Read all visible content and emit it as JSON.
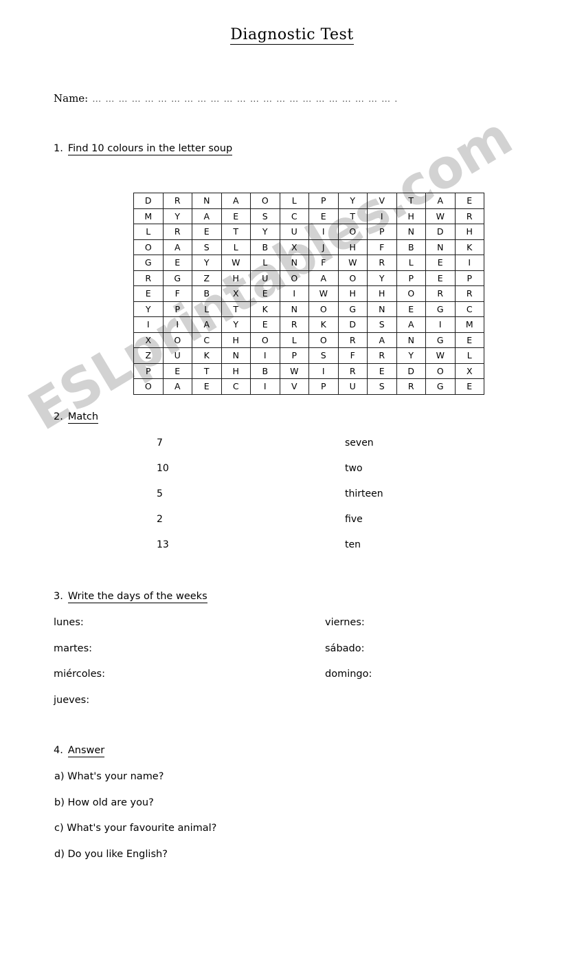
{
  "document": {
    "title": "Diagnostic Test",
    "watermark": "ESLprintables.com",
    "name_field": {
      "label": "Name:",
      "dots": "… … … … … … … … … … … … … … … … … … … … … … … ."
    }
  },
  "exercises": [
    {
      "number": "1.",
      "heading": "Find 10 colours in the letter soup"
    },
    {
      "number": "2.",
      "heading": "Match"
    },
    {
      "number": "3.",
      "heading": "Write the days of the weeks"
    },
    {
      "number": "4.",
      "heading": "Answer"
    }
  ],
  "word_search": {
    "rows": 13,
    "cols": 12,
    "grid": [
      [
        "D",
        "R",
        "N",
        "A",
        "O",
        "L",
        "P",
        "Y",
        "V",
        "T",
        "A",
        "E"
      ],
      [
        "M",
        "Y",
        "A",
        "E",
        "S",
        "C",
        "E",
        "T",
        "I",
        "H",
        "W",
        "R"
      ],
      [
        "L",
        "R",
        "E",
        "T",
        "Y",
        "U",
        "I",
        "O",
        "P",
        "N",
        "D",
        "H"
      ],
      [
        "O",
        "A",
        "S",
        "L",
        "B",
        "X",
        "J",
        "H",
        "F",
        "B",
        "N",
        "K"
      ],
      [
        "G",
        "E",
        "Y",
        "W",
        "L",
        "N",
        "F",
        "W",
        "R",
        "L",
        "E",
        "I"
      ],
      [
        "R",
        "G",
        "Z",
        "H",
        "U",
        "O",
        "A",
        "O",
        "Y",
        "P",
        "E",
        "P"
      ],
      [
        "E",
        "F",
        "B",
        "X",
        "E",
        "I",
        "W",
        "H",
        "H",
        "O",
        "R",
        "R"
      ],
      [
        "Y",
        "P",
        "L",
        "T",
        "K",
        "N",
        "O",
        "G",
        "N",
        "E",
        "G",
        "C"
      ],
      [
        "I",
        "I",
        "A",
        "Y",
        "E",
        "R",
        "K",
        "D",
        "S",
        "A",
        "I",
        "M"
      ],
      [
        "X",
        "O",
        "C",
        "H",
        "O",
        "L",
        "O",
        "R",
        "A",
        "N",
        "G",
        "E"
      ],
      [
        "Z",
        "U",
        "K",
        "N",
        "I",
        "P",
        "S",
        "F",
        "R",
        "Y",
        "W",
        "L"
      ],
      [
        "P",
        "E",
        "T",
        "H",
        "B",
        "W",
        "I",
        "R",
        "E",
        "D",
        "O",
        "X"
      ],
      [
        "O",
        "A",
        "E",
        "C",
        "I",
        "V",
        "P",
        "U",
        "S",
        "R",
        "G",
        "E"
      ]
    ]
  },
  "match": {
    "numbers": [
      "7",
      "10",
      "5",
      "2",
      "13"
    ],
    "words": [
      "seven",
      "two",
      "thirteen",
      "five",
      "ten"
    ]
  },
  "days": {
    "left": [
      "lunes:",
      "martes:",
      "miércoles:",
      "jueves:"
    ],
    "right": [
      "viernes:",
      "sábado:",
      "domingo:"
    ]
  },
  "questions": [
    "a) What's your name?",
    "b) How old are you?",
    "c) What's your favourite animal?",
    "d) Do you like English?"
  ]
}
